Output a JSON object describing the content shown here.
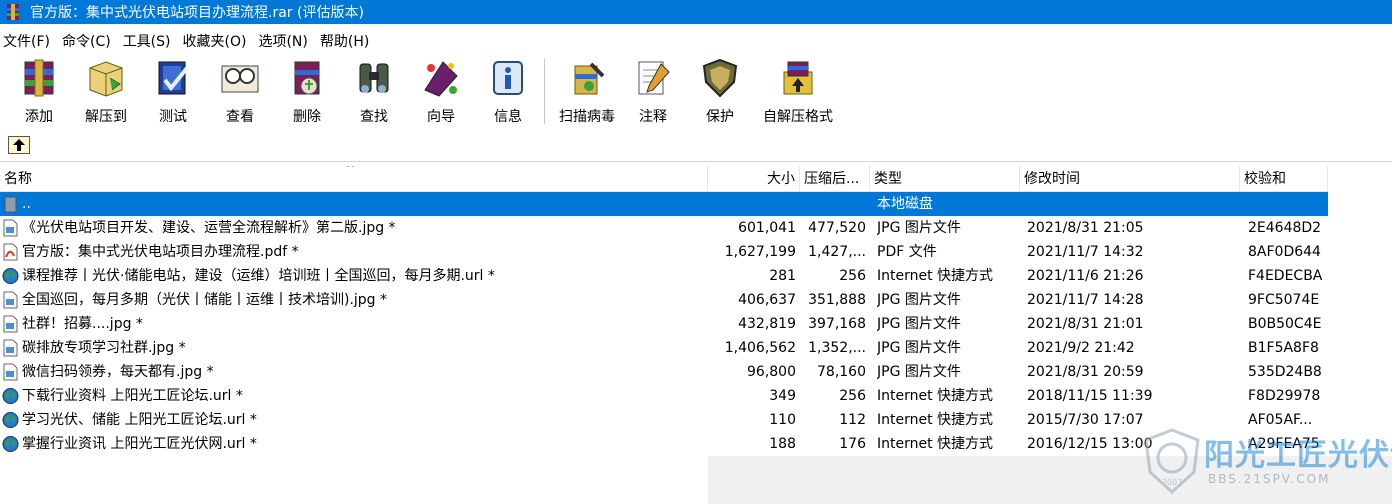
{
  "window": {
    "title": "官方版：集中式光伏电站项目办理流程.rar (评估版本)"
  },
  "menu": [
    {
      "label": "文件(F)"
    },
    {
      "label": "命令(C)"
    },
    {
      "label": "工具(S)"
    },
    {
      "label": "收藏夹(O)"
    },
    {
      "label": "选项(N)"
    },
    {
      "label": "帮助(H)"
    }
  ],
  "toolbar": [
    {
      "label": "添加",
      "icon": "add-archive-icon"
    },
    {
      "label": "解压到",
      "icon": "extract-to-icon"
    },
    {
      "label": "测试",
      "icon": "test-icon"
    },
    {
      "label": "查看",
      "icon": "view-icon"
    },
    {
      "label": "删除",
      "icon": "delete-icon"
    },
    {
      "label": "查找",
      "icon": "find-icon"
    },
    {
      "label": "向导",
      "icon": "wizard-icon"
    },
    {
      "label": "信息",
      "icon": "info-icon"
    },
    {
      "label": "扫描病毒",
      "icon": "virus-scan-icon"
    },
    {
      "label": "注释",
      "icon": "comment-icon"
    },
    {
      "label": "保护",
      "icon": "protect-icon"
    },
    {
      "label": "自解压格式",
      "icon": "sfx-icon"
    }
  ],
  "columns": {
    "name": "名称",
    "size": "大小",
    "packed": "压缩后...",
    "type": "类型",
    "modified": "修改时间",
    "crc": "校验和"
  },
  "rows": [
    {
      "name": "..",
      "size": "",
      "packed": "",
      "type": "本地磁盘",
      "modified": "",
      "crc": "",
      "icon": "parent-folder-icon",
      "selected": true
    },
    {
      "name": "《光伏电站项目开发、建设、运营全流程解析》第二版.jpg *",
      "size": "601,041",
      "packed": "477,520",
      "type": "JPG 图片文件",
      "modified": "2021/8/31 21:05",
      "crc": "2E4648D2",
      "icon": "jpg-file-icon"
    },
    {
      "name": "官方版：集中式光伏电站项目办理流程.pdf *",
      "size": "1,627,199",
      "packed": "1,427,...",
      "type": "PDF 文件",
      "modified": "2021/11/7 14:32",
      "crc": "8AF0D644",
      "icon": "pdf-file-icon"
    },
    {
      "name": "课程推荐丨光伏·储能电站，建设（运维）培训班丨全国巡回，每月多期.url *",
      "size": "281",
      "packed": "256",
      "type": "Internet 快捷方式",
      "modified": "2021/11/6 21:26",
      "crc": "F4EDECBA",
      "icon": "globe-icon"
    },
    {
      "name": "全国巡回，每月多期（光伏丨储能丨运维丨技术培训).jpg *",
      "size": "406,637",
      "packed": "351,888",
      "type": "JPG 图片文件",
      "modified": "2021/11/7 14:28",
      "crc": "9FC5074E",
      "icon": "jpg-file-icon"
    },
    {
      "name": "社群！招募....jpg *",
      "size": "432,819",
      "packed": "397,168",
      "type": "JPG 图片文件",
      "modified": "2021/8/31 21:01",
      "crc": "B0B50C4E",
      "icon": "jpg-file-icon"
    },
    {
      "name": "碳排放专项学习社群.jpg *",
      "size": "1,406,562",
      "packed": "1,352,...",
      "type": "JPG 图片文件",
      "modified": "2021/9/2 21:42",
      "crc": "B1F5A8F8",
      "icon": "jpg-file-icon"
    },
    {
      "name": "微信扫码领券，每天都有.jpg *",
      "size": "96,800",
      "packed": "78,160",
      "type": "JPG 图片文件",
      "modified": "2021/8/31 20:59",
      "crc": "535D24B8",
      "icon": "jpg-file-icon"
    },
    {
      "name": "下载行业资料 上阳光工匠论坛.url *",
      "size": "349",
      "packed": "256",
      "type": "Internet 快捷方式",
      "modified": "2018/11/15 11:39",
      "crc": "F8D29978",
      "icon": "globe-icon"
    },
    {
      "name": "学习光伏、储能 上阳光工匠论坛.url *",
      "size": "110",
      "packed": "112",
      "type": "Internet 快捷方式",
      "modified": "2015/7/30 17:07",
      "crc": "AF05AF...",
      "icon": "globe-icon"
    },
    {
      "name": "掌握行业资讯 上阳光工匠光伏网.url *",
      "size": "188",
      "packed": "176",
      "type": "Internet 快捷方式",
      "modified": "2016/12/15 13:00",
      "crc": "A29FEA75",
      "icon": "globe-icon"
    }
  ],
  "watermark": {
    "title": "阳光工匠光伏论坛",
    "url": "BBS.21SPV.COM",
    "year": "2007"
  },
  "colors": {
    "titlebar": "#0078d7",
    "selection": "#0078d7",
    "watermark": "#1d8ad6"
  }
}
